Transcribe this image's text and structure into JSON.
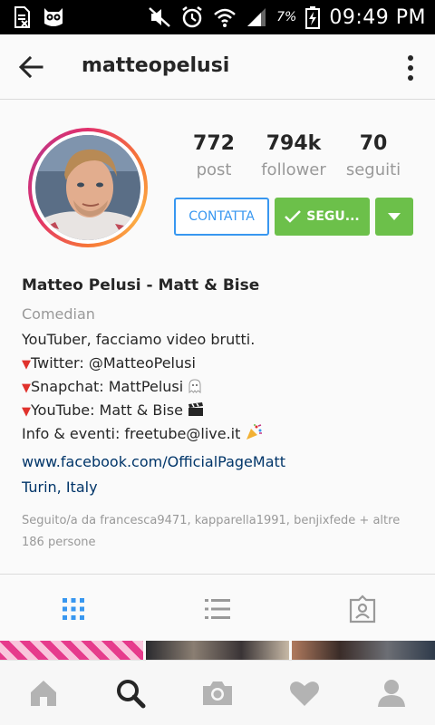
{
  "status_bar": {
    "battery_percent": "7%",
    "time": "09:49 PM"
  },
  "header": {
    "username": "matteopelusi"
  },
  "profile": {
    "stats": [
      {
        "value": "772",
        "label": "post"
      },
      {
        "value": "794k",
        "label": "follower"
      },
      {
        "value": "70",
        "label": "seguiti"
      }
    ],
    "contact_label": "CONTATTA",
    "follow_label": "SEGU...",
    "name": "Matteo Pelusi - Matt & Bise",
    "category": "Comedian",
    "bio_lines": [
      "YouTuber, facciamo video brutti.",
      "Twitter: @MatteoPelusi",
      "Snapchat: MattPelusi",
      "YouTube: Matt & Bise",
      "Info & eventi: freetube@live.it"
    ],
    "website": "www.facebook.com/OfficialPageMatt",
    "location": "Turin, Italy",
    "followed_by": "Seguito/a da francesca9471, kapparella1991, benjixfede + altre 186 persone"
  },
  "tabs": [
    "grid-view",
    "list-view",
    "tagged-view"
  ],
  "bottom_nav": [
    "home",
    "search",
    "camera",
    "activity",
    "profile"
  ],
  "colors": {
    "follow_green": "#6cc04a",
    "contact_blue": "#3897f0",
    "link_blue": "#003569",
    "active_tab_blue": "#3897f0"
  }
}
